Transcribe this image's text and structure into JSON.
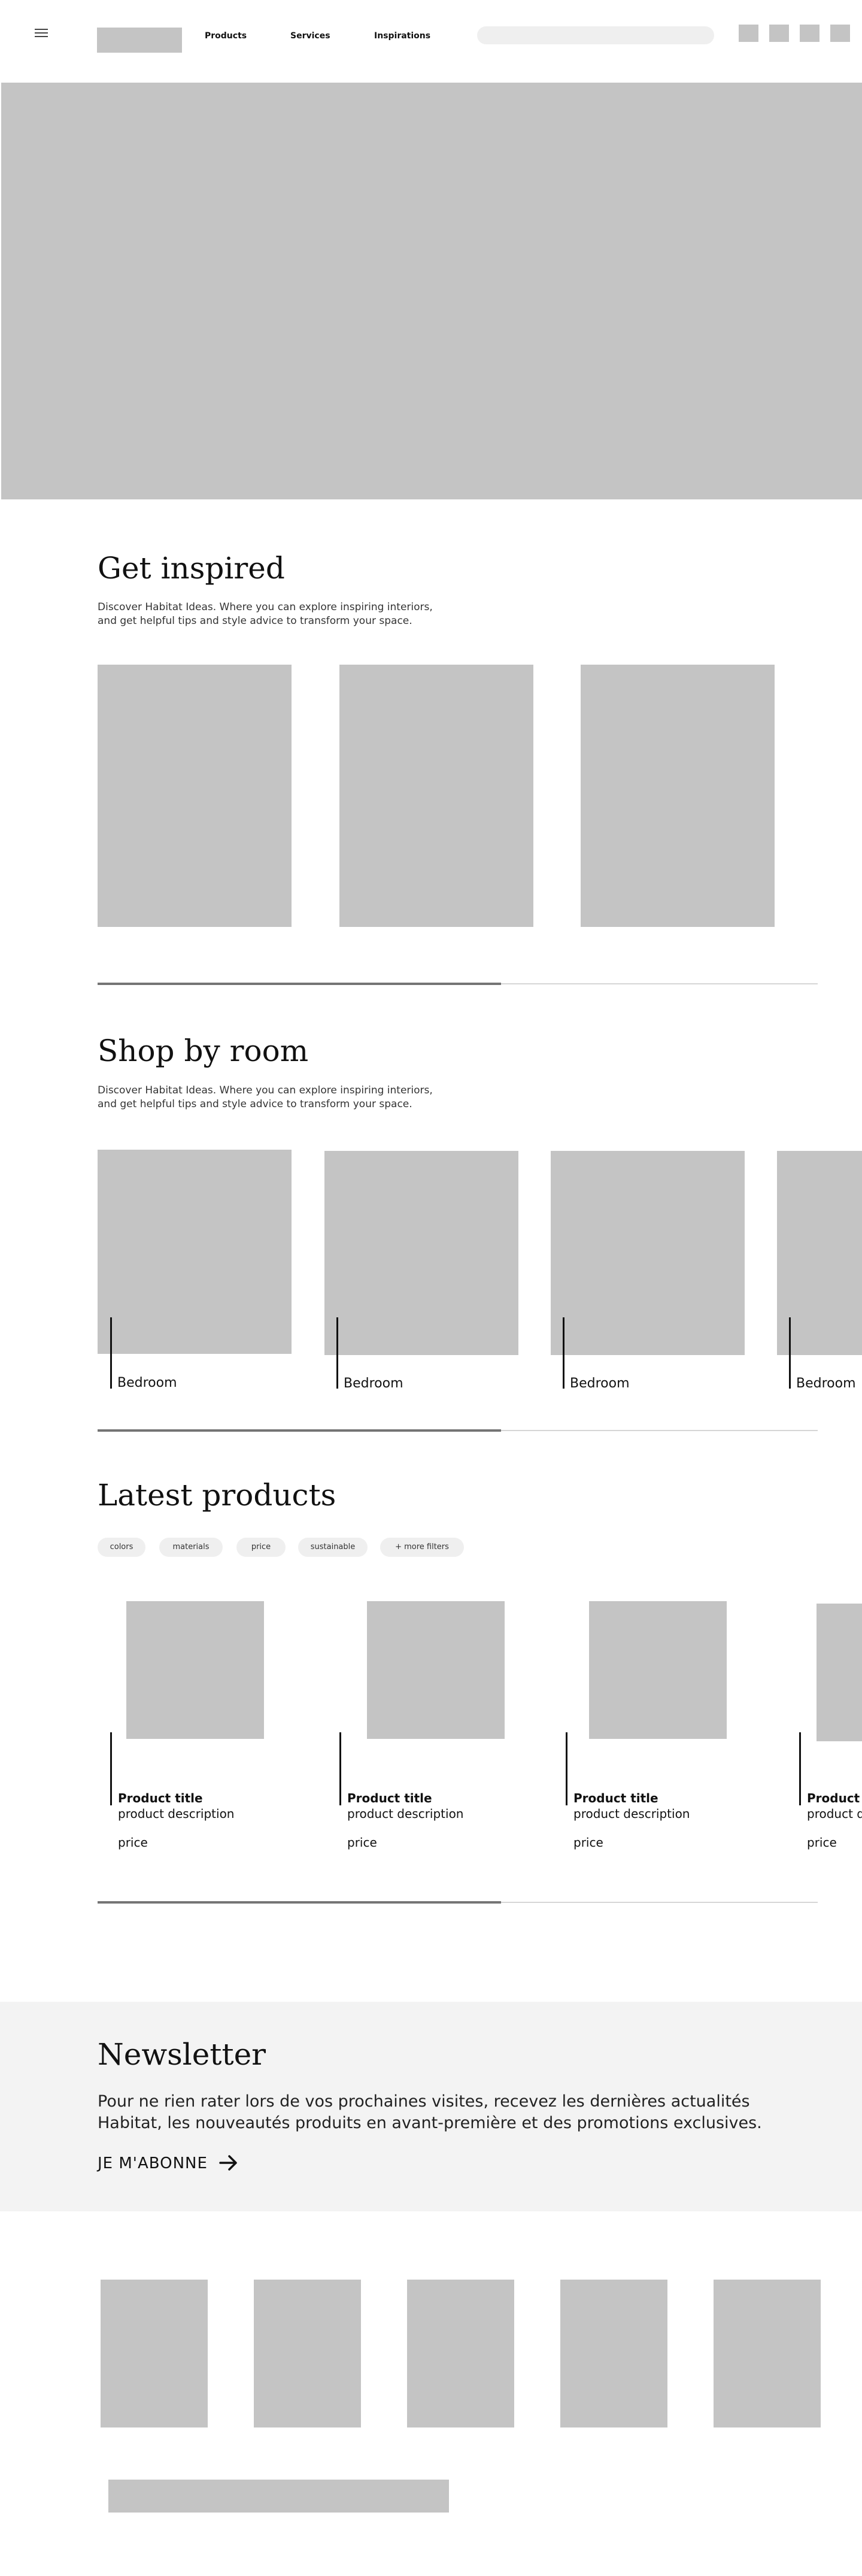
{
  "header": {
    "nav": [
      "Products",
      "Services",
      "Inspirations"
    ]
  },
  "inspired": {
    "title": "Get inspired",
    "intro": "Discover Habitat Ideas. Where you can explore inspiring interiors, and get helpful tips and style advice to transform your space.",
    "scroll_progress_percent": 56
  },
  "shop_by_room": {
    "title": "Shop by room",
    "intro": "Discover Habitat Ideas. Where you can explore inspiring interiors, and get helpful tips and style advice to transform your space.",
    "rooms": [
      {
        "label": "Bedroom"
      },
      {
        "label": "Bedroom"
      },
      {
        "label": "Bedroom"
      },
      {
        "label": "Bedroom"
      }
    ],
    "scroll_progress_percent": 56
  },
  "latest": {
    "title": "Latest products",
    "filters": [
      "colors",
      "materials",
      "price",
      "sustainable",
      "+ more filters"
    ],
    "products": [
      {
        "title": "Product title",
        "description": "product description",
        "price": "price"
      },
      {
        "title": "Product title",
        "description": "product description",
        "price": "price"
      },
      {
        "title": "Product title",
        "description": "product description",
        "price": "price"
      },
      {
        "title": "Product title",
        "description": "product description",
        "price": "price"
      }
    ],
    "scroll_progress_percent": 56
  },
  "newsletter": {
    "title": "Newsletter",
    "text": "Pour ne rien rater lors de vos prochaines visites, recevez les dernières actualités Habitat, les nouveautés produits en avant-première et des promotions exclusives.",
    "cta": "JE M'ABONNE"
  },
  "colors": {
    "placeholder": "#c4c4c4",
    "newsletter_bg": "#f3f3f3",
    "chip_bg": "#efefef"
  }
}
